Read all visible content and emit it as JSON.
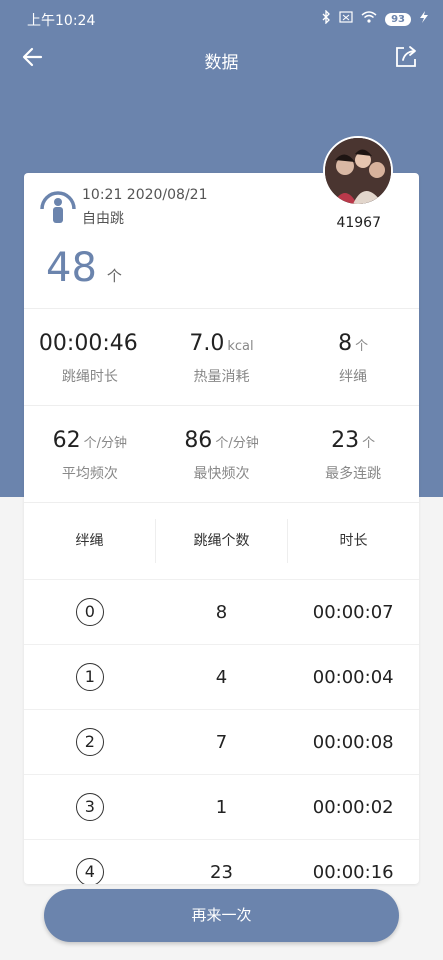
{
  "status_bar": {
    "time": "上午10:24",
    "battery": "93",
    "icons": [
      "bluetooth-icon",
      "sim-icon",
      "wifi-icon",
      "battery-icon",
      "charging-icon"
    ]
  },
  "header": {
    "title": "数据",
    "back_icon": "arrow-left-icon",
    "share_icon": "share-icon"
  },
  "session": {
    "datetime": "10:21 2020/08/21",
    "mode": "自由跳",
    "count": "48",
    "count_unit": "个",
    "user_id": "41967"
  },
  "stats": [
    {
      "value": "00:00:46",
      "unit": "",
      "label": "跳绳时长"
    },
    {
      "value": "7.0",
      "unit": "kcal",
      "label": "热量消耗"
    },
    {
      "value": "8",
      "unit": "个",
      "label": "绊绳"
    },
    {
      "value": "62",
      "unit": "个/分钟",
      "label": "平均频次"
    },
    {
      "value": "86",
      "unit": "个/分钟",
      "label": "最快频次"
    },
    {
      "value": "23",
      "unit": "个",
      "label": "最多连跳"
    }
  ],
  "table": {
    "headers": [
      "绊绳",
      "跳绳个数",
      "时长"
    ],
    "rows": [
      {
        "index": "0",
        "count": "8",
        "duration": "00:00:07"
      },
      {
        "index": "1",
        "count": "4",
        "duration": "00:00:04"
      },
      {
        "index": "2",
        "count": "7",
        "duration": "00:00:08"
      },
      {
        "index": "3",
        "count": "1",
        "duration": "00:00:02"
      },
      {
        "index": "4",
        "count": "23",
        "duration": "00:00:16"
      }
    ]
  },
  "action": {
    "label": "再来一次"
  },
  "colors": {
    "primary": "#6b84ad",
    "background": "#f4f4f4"
  }
}
